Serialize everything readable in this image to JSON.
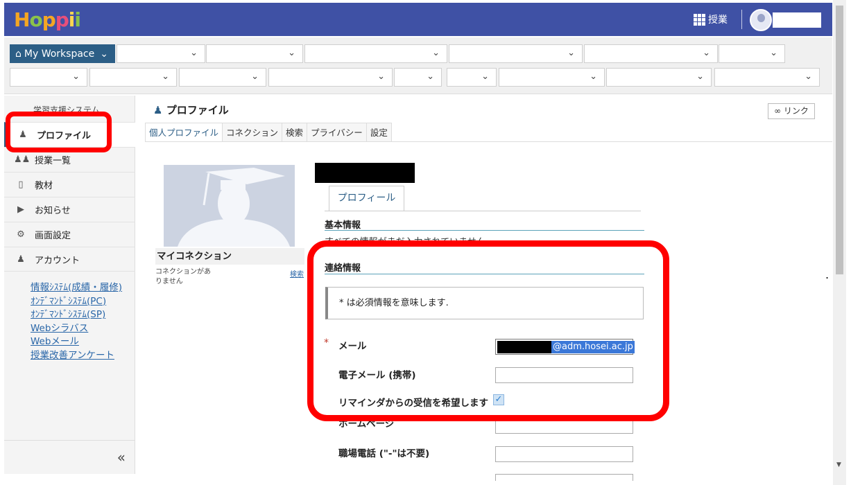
{
  "header": {
    "logo": "Hoppii",
    "classes_label": "授業",
    "colors": {
      "header_bg": "#3f51a5",
      "accent": "#2c5e86",
      "highlight": "#ff0000"
    }
  },
  "coursebar": {
    "workspace_label": "My Workspace"
  },
  "sidebar": {
    "site_name": "学習支援システム",
    "items": [
      {
        "label": "プロファイル",
        "icon": "user-icon"
      },
      {
        "label": "授業一覧",
        "icon": "users-icon"
      },
      {
        "label": "教材",
        "icon": "folder-icon"
      },
      {
        "label": "お知らせ",
        "icon": "megaphone-icon"
      },
      {
        "label": "画面設定",
        "icon": "gear-icon"
      },
      {
        "label": "アカウント",
        "icon": "user-icon"
      }
    ],
    "links": [
      "情報ｼｽﾃﾑ(成績・履修)",
      "ｵﾝﾃﾞﾏﾝﾄﾞｼｽﾃﾑ(PC)",
      "ｵﾝﾃﾞﾏﾝﾄﾞｼｽﾃﾑ(SP)",
      "Webシラバス",
      "Webメール",
      "授業改善アンケート"
    ],
    "collapse_label": "«"
  },
  "main": {
    "title": "プロファイル",
    "link_button": "リンク",
    "tabs": [
      "個人プロファイル",
      "コネクション",
      "検索",
      "プライバシー",
      "設定"
    ],
    "connections": {
      "heading": "マイコネクション",
      "empty_text": "コネクションがありません",
      "search_link": "検索"
    },
    "profile_tab": "プロフィール",
    "basic_info": {
      "heading": "基本情報",
      "message": "すべての情報がまだ入力されていません"
    },
    "contact": {
      "heading": "連絡情報",
      "required_note": "* は必須情報を意味します.",
      "email_label": "メール",
      "email_domain": "@adm.hosei.ac.jp",
      "mobile_email_label": "電子メール (携帯)",
      "reminder_label": "リマインダからの受信を希望します",
      "reminder_checked": true,
      "homepage_label": "ホームページ",
      "work_phone_label": "職場電話 (\"-\"は不要)"
    }
  }
}
